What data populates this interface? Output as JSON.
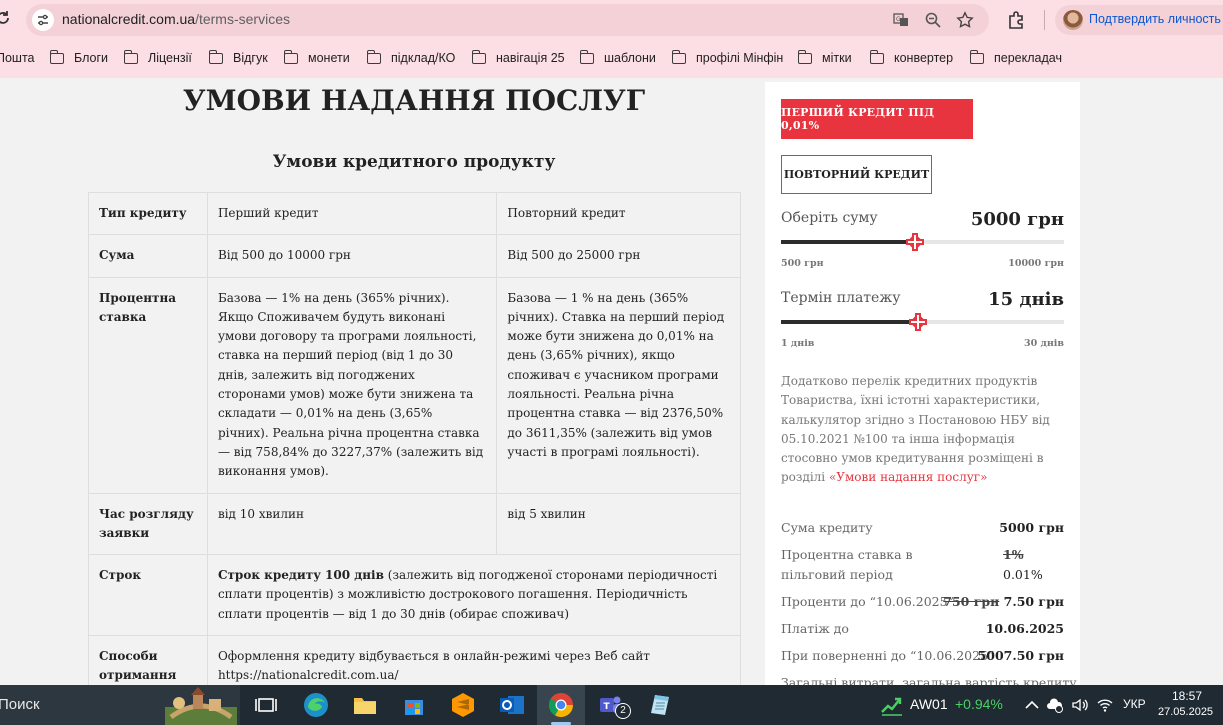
{
  "browser": {
    "url_host": "nationalcredit.com.ua",
    "url_path": "/terms-services",
    "profile_label": "Подтвердить личность",
    "bookmarks": [
      "Пошта",
      "Блоги",
      "Ліцензії",
      "Відгук",
      "монети",
      "підклад/КО",
      "навігація 25",
      "шаблони",
      "профілі Мінфін",
      "мітки",
      "конвертер",
      "перекладач"
    ]
  },
  "page": {
    "title": "УМОВИ НАДАННЯ ПОСЛУГ",
    "subtitle": "Умови кредитного продукту",
    "table": {
      "rows": [
        {
          "head": "Тип кредиту",
          "first": "Перший кредит",
          "repeat": "Повторний кредит"
        },
        {
          "head": "Сума",
          "first": "Від 500 до 10000 грн",
          "repeat": "Від 500 до 25000 грн"
        },
        {
          "head": "Процентна ставка",
          "first": "Базова — 1% на день (365% річних). Якщо Споживачем будуть виконані умови договору та програми лояльності, ставка на перший період (від 1 до 30 днів, залежить від погоджених сторонами умов) може бути знижена та складати — 0,01% на день (3,65% річних). Реальна річна процентна ставка — від 758,84% до 3227,37% (залежить від виконання умов).",
          "repeat": "Базова — 1 % на день (365% річних). Ставка на перший період може бути знижена до 0,01% на день (3,65% річних), якщо споживач є учасником програми лояльності. Реальна річна процентна ставка — від 2376,50% до 3611,35% (залежить від умов участі в програмі лояльності)."
        },
        {
          "head": "Час розгляду заявки",
          "first": "від 10 хвилин",
          "repeat": "від 5 хвилин"
        },
        {
          "head": "Строк",
          "merged_bold": "Строк кредиту 100 днів",
          "merged_rest": " (залежить від погодженої сторонами періодичності сплати процентів) з можливістю дострокового погашення. Періодичність сплати процентів — від 1 до 30 днів (обирає споживач)"
        },
        {
          "head": "Способи отримання кредиту",
          "merged": "Оформлення кредиту відбувається в онлайн-режимі через Веб сайт https://nationalcredit.com.ua/"
        }
      ]
    }
  },
  "sidebar": {
    "first_credit_button": "ПЕРШИЙ КРЕДИТ ПІД 0,01%",
    "repeat_credit_button": "ПОВТОРНИЙ КРЕДИТ",
    "amount": {
      "label": "Оберіть суму",
      "value": "5000 грн",
      "min": "500 грн",
      "max": "10000 грн",
      "fraction": 0.474
    },
    "term": {
      "label": "Термін платежу",
      "value": "15 днів",
      "min": "1 днів",
      "max": "30 днів",
      "fraction": 0.483
    },
    "note_text": "Додатково перелік кредитних продуктів Товариства, їхні істотні характеристики, калькулятор згідно з Постановою НБУ від 05.10.2021 №100 та інша інформація стосовно умов кредитування розміщені в розділі ",
    "note_link": "«Умови надання послуг»",
    "summary": {
      "amount_label": "Сума кредиту",
      "amount_value": "5000 грн",
      "rate_label": "Процентна ставка в пільговий період",
      "rate_old": "1%",
      "rate_new": "0.01%",
      "interest_label": "Проценти до “10.06.2025”",
      "interest_old": "750 грн",
      "interest_new": "7.50 грн",
      "payment_label": "Платіж до",
      "payment_value": "10.06.2025",
      "return_label": "При поверненні до “10.06.2025”",
      "return_value": "5007.50 грн",
      "total_label": "Загальні витрати, загальна вартість кредиту"
    }
  },
  "taskbar": {
    "search_label": "Поиск",
    "stock_name": "AW01",
    "stock_change": "+0.94%",
    "language": "УКР",
    "time": "18:57",
    "date": "27.05.2025",
    "teams_badge": "2"
  },
  "colors": {
    "accent": "#e7343f",
    "chrome": "#fbdfe4",
    "taskbar": "#1f2a33"
  }
}
